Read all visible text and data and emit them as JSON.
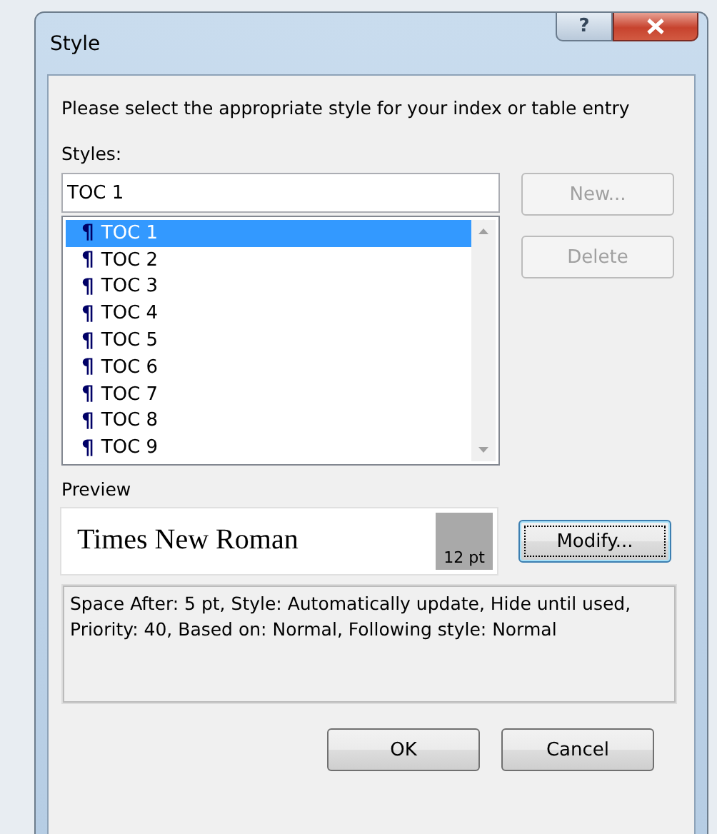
{
  "window": {
    "title": "Style",
    "help": "?"
  },
  "instruction": "Please select the appropriate style for your index or table entry",
  "styles_label": "Styles:",
  "style_field": {
    "value": "TOC 1"
  },
  "styles": [
    {
      "marker": "¶",
      "label": "TOC 1",
      "selected": true
    },
    {
      "marker": "¶",
      "label": "TOC 2",
      "selected": false
    },
    {
      "marker": "¶",
      "label": "TOC 3",
      "selected": false
    },
    {
      "marker": "¶",
      "label": "TOC 4",
      "selected": false
    },
    {
      "marker": "¶",
      "label": "TOC 5",
      "selected": false
    },
    {
      "marker": "¶",
      "label": "TOC 6",
      "selected": false
    },
    {
      "marker": "¶",
      "label": "TOC 7",
      "selected": false
    },
    {
      "marker": "¶",
      "label": "TOC 8",
      "selected": false
    },
    {
      "marker": "¶",
      "label": "TOC 9",
      "selected": false
    }
  ],
  "side_buttons": [
    {
      "label": "New...",
      "disabled": true
    },
    {
      "label": "Delete",
      "disabled": true
    }
  ],
  "preview": {
    "label": "Preview",
    "font_name": "Times New Roman",
    "size": "12 pt"
  },
  "modify_button": "Modify...",
  "description": "Space After:  5 pt, Style: Automatically update, Hide until used, Priority: 40, Based on: Normal, Following style: Normal",
  "buttons": [
    "OK",
    "Cancel"
  ]
}
